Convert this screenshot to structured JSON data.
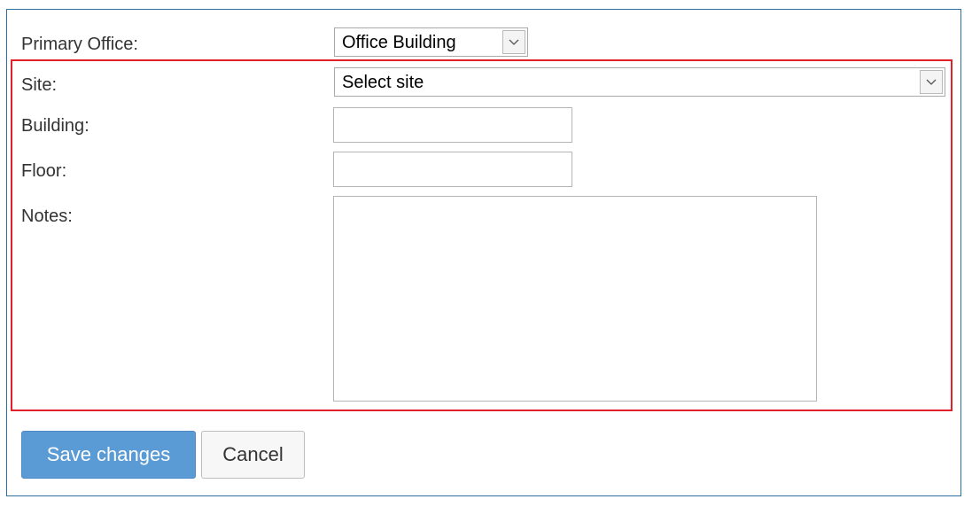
{
  "form": {
    "primary_office": {
      "label": "Primary Office:",
      "selected": "Office Building",
      "icon": "chevron-down-icon"
    },
    "site": {
      "label": "Site:",
      "selected": "Select site",
      "icon": "chevron-down-icon"
    },
    "building": {
      "label": "Building:",
      "value": ""
    },
    "floor": {
      "label": "Floor:",
      "value": ""
    },
    "notes": {
      "label": "Notes:",
      "value": ""
    }
  },
  "actions": {
    "save_label": "Save changes",
    "cancel_label": "Cancel"
  },
  "colors": {
    "panel_border": "#2f6f9f",
    "highlight_border": "#e2202a",
    "primary_button": "#5b9bd5"
  }
}
